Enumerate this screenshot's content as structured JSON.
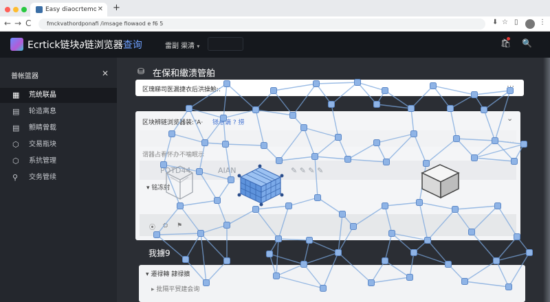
{
  "browser": {
    "tab_title": "Easy diaocrtemocysutit",
    "tab_close": "✕",
    "new_tab": "+",
    "back": "←",
    "forward": "→",
    "reload": "C",
    "url": "fmckvathordponafi /imsage fiowaod e f6 5",
    "tool_icons": [
      "⬇",
      "☆",
      "▯",
      "⋮"
    ]
  },
  "header": {
    "app_name": "Ecrtick链块∂链浏览器",
    "app_name_accent": "查询",
    "dropdown_label": "雷副 渠清",
    "dropdown_caret": "▾",
    "bag_icon": "🛍",
    "search_icon": "🔍"
  },
  "sidebar": {
    "title": "普帐篮器",
    "close": "✕",
    "items": [
      {
        "icon": "▦",
        "label": "荒统联晶",
        "active": true
      },
      {
        "icon": "▤",
        "label": "轮造离息",
        "active": false
      },
      {
        "icon": "▤",
        "label": "颤睛曾载",
        "active": false
      },
      {
        "icon": "⬡",
        "label": "交易瓶块",
        "active": false
      },
      {
        "icon": "⬡",
        "label": "系抗管理",
        "active": false
      },
      {
        "icon": "⚲",
        "label": "交务管续",
        "active": false
      }
    ]
  },
  "main": {
    "title_icon": "⛁",
    "title": "在保和繖溃管舶",
    "card1": {
      "text": "区瑰睇司医漏捷衣后洪操鮐::",
      "more": "⋯"
    },
    "card2": {
      "text": "区块辨链浏览器装:\"A·",
      "link": "铩悬谪 ? 捞",
      "toggle": "⌄",
      "more": "⋯",
      "sub_text": "谓器占看怀办不噛眠示",
      "faded_1": "POTD44",
      "faded_2": "AIAN",
      "faded_3": "✎ ✎ ✎ ✎",
      "expand_label": "铭冻射",
      "chips": [
        "⦿",
        "⛭",
        "⚑"
      ]
    },
    "section2_title": "我擄9",
    "card3": {
      "text": "遷禄轉 隷禄擴",
      "sub": "批隔平贸建会询"
    },
    "expand_caret": "▾",
    "collapse_caret": "▸"
  },
  "colors": {
    "accent": "#6ea0ff",
    "node_fill": "#8fb4e6",
    "node_stroke": "#5b87c7",
    "edge": "#7aa6dc",
    "header_bg": "#15181d",
    "sidebar_bg": "#24272d",
    "main_bg": "#2b2e34"
  }
}
